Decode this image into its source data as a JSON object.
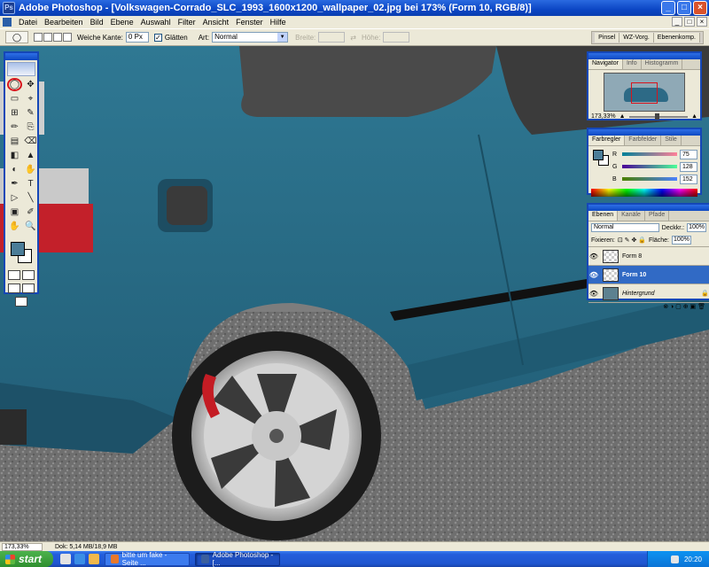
{
  "window": {
    "title": "Adobe Photoshop - [Volkswagen-Corrado_SLC_1993_1600x1200_wallpaper_02.jpg bei 173% (Form 10, RGB/8)]",
    "app_icon_text": "Ps",
    "minimize": "_",
    "maximize": "□",
    "close": "×"
  },
  "menu": {
    "items": [
      "Datei",
      "Bearbeiten",
      "Bild",
      "Ebene",
      "Auswahl",
      "Filter",
      "Ansicht",
      "Fenster",
      "Hilfe"
    ],
    "doc_minimize": "_",
    "doc_restore": "□",
    "doc_close": "×"
  },
  "options": {
    "tool_glyph": "◯",
    "feather_label": "Weiche Kante:",
    "feather_value": "0 Px",
    "antialias_label": "Glätten",
    "antialias_checked": "✓",
    "style_label": "Art:",
    "style_value": "Normal",
    "width_label": "Breite:",
    "height_label": "Höhe:",
    "swap_glyph": "⇄",
    "palette_well": [
      "Pinsel",
      "WZ-Vorg.",
      "Ebenenkomp."
    ]
  },
  "toolbox": {
    "tools": [
      "◯",
      "✥",
      "▭",
      "⌖",
      "⊞",
      "✎",
      "✏",
      "⎘",
      "▤",
      "⌫",
      "◧",
      "▲",
      "◐",
      "✋",
      "✒",
      "T",
      "▷",
      "╲",
      "▣",
      "✐",
      "✋",
      "🔍"
    ],
    "fg_color": "#4b7d98",
    "bg_color": "#ffffff"
  },
  "navigator": {
    "tabs": [
      "Navigator",
      "Info",
      "Histogramm"
    ],
    "zoom": "173,33%",
    "zoom_out": "▲",
    "zoom_in": "▲"
  },
  "color": {
    "tabs": [
      "Farbregler",
      "Farbfelder",
      "Stile"
    ],
    "channels": [
      {
        "label": "R",
        "value": "75"
      },
      {
        "label": "G",
        "value": "128"
      },
      {
        "label": "B",
        "value": "152"
      }
    ],
    "fg_color": "#4b7d98"
  },
  "layers": {
    "tabs": [
      "Ebenen",
      "Kanäle",
      "Pfade"
    ],
    "blend_mode": "Normal",
    "opacity_label": "Deckkr.:",
    "opacity_value": "100%",
    "lock_label": "Fixieren:",
    "lock_icons": "⊡ ✎ ✥ 🔒",
    "fill_label": "Fläche:",
    "fill_value": "100%",
    "items": [
      {
        "name": "Form 8",
        "eye": "👁"
      },
      {
        "name": "Form 10",
        "eye": "👁"
      },
      {
        "name": "Hintergrund",
        "eye": "👁",
        "lock": "🔒"
      }
    ],
    "footer_icons": "⊗ ◑ ▢ ⊕ ▣ 🗑"
  },
  "status": {
    "zoom": "173,33%",
    "doc": "Dok: 5,14 MB/18,9 MB"
  },
  "taskbar": {
    "start": "start",
    "tasks": [
      {
        "label": "bitte um fake - Seite ...",
        "active": false
      },
      {
        "label": "Adobe Photoshop - [...",
        "active": true
      }
    ],
    "clock": "20:20"
  }
}
